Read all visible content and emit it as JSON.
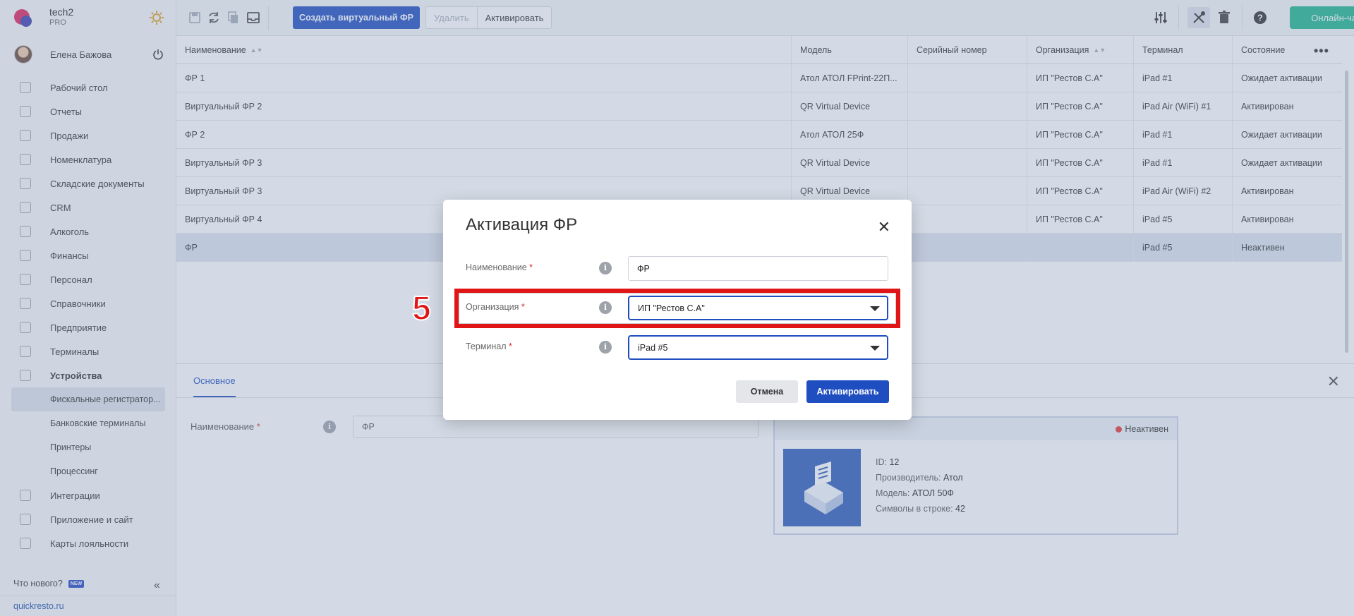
{
  "brand": {
    "name": "tech2",
    "plan": "PRO"
  },
  "user": {
    "name": "Елена Бажова"
  },
  "nav": {
    "items": [
      {
        "label": "Рабочий стол",
        "icon": "dashboard-icon"
      },
      {
        "label": "Отчеты",
        "icon": "chart-icon"
      },
      {
        "label": "Продажи",
        "icon": "basket-icon"
      },
      {
        "label": "Номенклатура",
        "icon": "tag-icon"
      },
      {
        "label": "Складские документы",
        "icon": "archive-icon"
      },
      {
        "label": "CRM",
        "icon": "users-icon"
      },
      {
        "label": "Алкоголь",
        "icon": "glass-icon"
      },
      {
        "label": "Финансы",
        "icon": "wallet-icon"
      },
      {
        "label": "Персонал",
        "icon": "people-icon"
      },
      {
        "label": "Справочники",
        "icon": "book-icon"
      },
      {
        "label": "Предприятие",
        "icon": "building-icon"
      },
      {
        "label": "Терминалы",
        "icon": "terminal-icon"
      },
      {
        "label": "Устройства",
        "icon": "printer-icon"
      }
    ],
    "sub_items": [
      {
        "label": "Фискальные регистратор..."
      },
      {
        "label": "Банковские терминалы"
      },
      {
        "label": "Принтеры"
      },
      {
        "label": "Процессинг"
      }
    ],
    "items_after": [
      {
        "label": "Интеграции",
        "icon": "link-icon"
      },
      {
        "label": "Приложение и сайт",
        "icon": "app-icon"
      },
      {
        "label": "Карты лояльности",
        "icon": "card-icon"
      }
    ],
    "whats_new": "Что нового?",
    "new_badge": "NEW",
    "site": "quickresto.ru"
  },
  "toolbar": {
    "create_label": "Создать виртуальный ФР",
    "delete_label": "Удалить",
    "activate_label": "Активировать",
    "online_chat": "Онлайн-чат"
  },
  "table": {
    "headers": [
      "Наименование",
      "Модель",
      "Серийный номер",
      "Организация",
      "Терминал",
      "Состояние"
    ],
    "rows": [
      [
        "ФР 1",
        "Атол АТОЛ FPrint-22П...",
        "",
        "ИП \"Рестов С.А\"",
        "iPad #1",
        "Ожидает активации"
      ],
      [
        "Виртуальный ФР 2",
        "QR Virtual Device",
        "",
        "ИП \"Рестов С.А\"",
        "iPad Air (WiFi) #1",
        "Активирован"
      ],
      [
        "ФР 2",
        "Атол АТОЛ 25Ф",
        "",
        "ИП \"Рестов С.А\"",
        "iPad #1",
        "Ожидает активации"
      ],
      [
        "Виртуальный ФР 3",
        "QR Virtual Device",
        "",
        "ИП \"Рестов С.А\"",
        "iPad #1",
        "Ожидает активации"
      ],
      [
        "Виртуальный ФР 3",
        "QR Virtual Device",
        "",
        "ИП \"Рестов С.А\"",
        "iPad Air (WiFi) #2",
        "Активирован"
      ],
      [
        "Виртуальный ФР 4",
        "",
        "",
        "ИП \"Рестов С.А\"",
        "iPad #5",
        "Активирован"
      ],
      [
        "ФР",
        "",
        "",
        "",
        "iPad #5",
        "Неактивен"
      ]
    ]
  },
  "details": {
    "tab": "Основное",
    "name_label": "Наименование",
    "name_placeholder": "ФР",
    "status": "Неактивен",
    "id_label": "ID:",
    "id": "12",
    "maker_label": "Производитель:",
    "maker": "Атол",
    "model_label": "Модель:",
    "model": "АТОЛ 50Ф",
    "chars_label": "Символы в строке:",
    "chars": "42"
  },
  "modal": {
    "title": "Активация ФР",
    "name_label": "Наименование",
    "name_value": "ФР",
    "org_label": "Организация",
    "org_value": "ИП \"Рестов С.А\"",
    "terminal_label": "Терминал",
    "terminal_value": "iPad #5",
    "cancel": "Отмена",
    "activate": "Активировать",
    "required_mark": "*"
  },
  "annotation": {
    "step": "5",
    "color": "#e01515"
  },
  "colors": {
    "primary": "#1f4ec1",
    "chat": "#1fb58c",
    "status_inactive": "#e53935"
  }
}
